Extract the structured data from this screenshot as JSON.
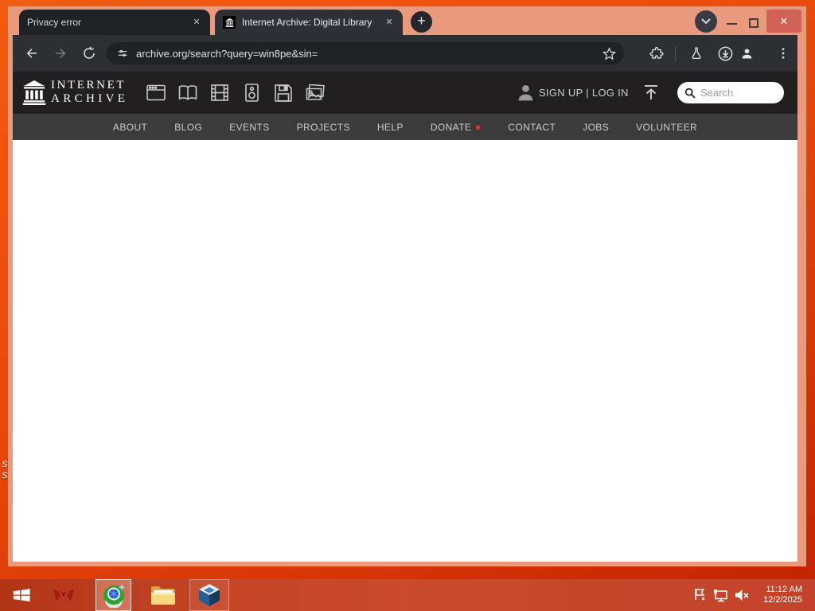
{
  "browser": {
    "tabs": [
      {
        "title": "Privacy error"
      },
      {
        "title": "Internet Archive: Digital Library"
      }
    ],
    "tab_close_glyph": "✕",
    "new_tab_glyph": "+",
    "controls": {
      "close_glyph": "✕"
    },
    "url": "archive.org/search?query=win8pe&sin="
  },
  "ia": {
    "wordmark_line1": "INTERNET",
    "wordmark_line2": "ARCHIVE",
    "signup_login": "SIGN UP | LOG IN",
    "search_placeholder": "Search",
    "nav_items": [
      "ABOUT",
      "BLOG",
      "EVENTS",
      "PROJECTS",
      "HELP",
      "DONATE",
      "CONTACT",
      "JOBS",
      "VOLUNTEER"
    ],
    "donate_heart": "♥"
  },
  "taskbar": {
    "clock_time": "11:12 AM",
    "clock_date": "12/2/2025"
  },
  "desktop": {
    "fragments": [
      "S",
      "S"
    ]
  },
  "colors": {
    "desktop_orange": "#e8470b",
    "titlebar_salmon": "#ea9a7c",
    "toolbar_dark": "#2e2f33",
    "ia_header_dark": "#211f20",
    "nav_gray": "#3b3b3b",
    "taskbar_red": "#c2452a",
    "heart_red": "#e6392e",
    "close_btn_red": "#cf6156"
  }
}
